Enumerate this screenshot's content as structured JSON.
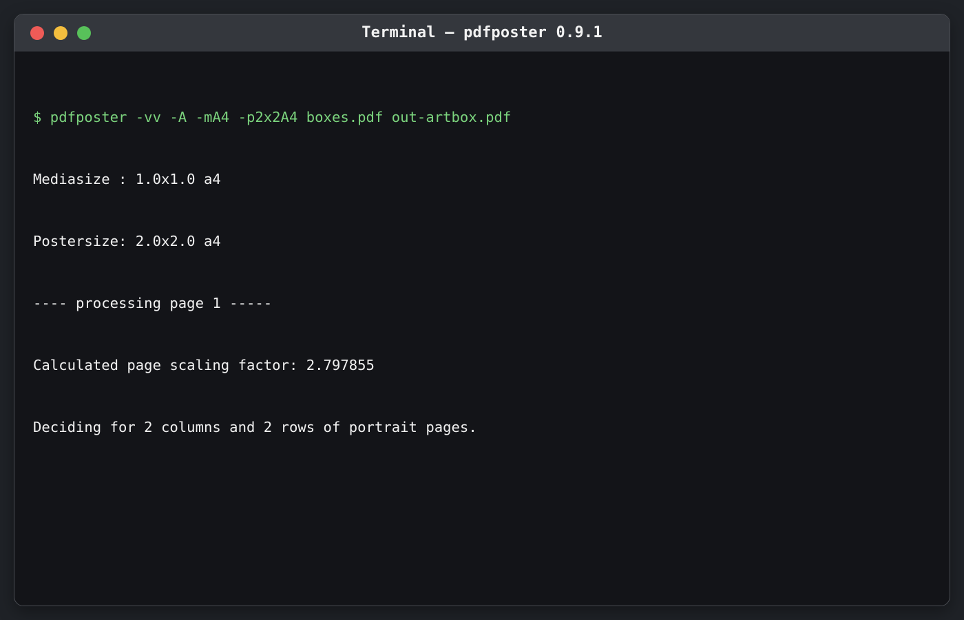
{
  "window": {
    "title": "Terminal — pdfposter 0.9.1",
    "controls": {
      "close_color": "#ee5b57",
      "minimize_color": "#f4be3e",
      "maximize_color": "#58c15a"
    }
  },
  "terminal": {
    "command": "$ pdfposter -vv -A -mA4 -p2x2A4 boxes.pdf out-artbox.pdf",
    "output": [
      "Mediasize : 1.0x1.0 a4",
      "Postersize: 2.0x2.0 a4",
      "---- processing page 1 -----",
      "Calculated page scaling factor: 2.797855",
      "Deciding for 2 columns and 2 rows of portrait pages."
    ],
    "colors": {
      "command": "#7bd37d",
      "output": "#f0f0f0",
      "background": "#131418"
    }
  }
}
